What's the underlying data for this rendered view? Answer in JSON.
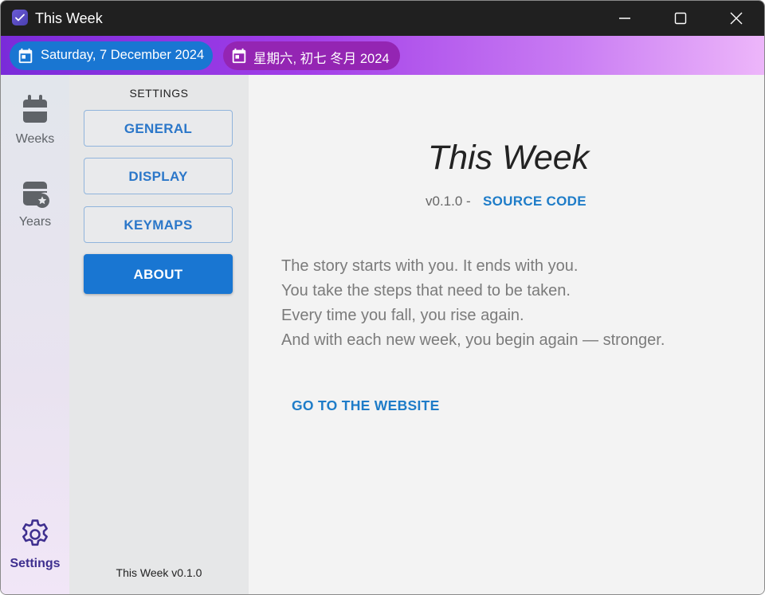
{
  "window": {
    "title": "This Week",
    "icon": "app-check-icon",
    "controls": [
      "minimize-icon",
      "maximize-icon",
      "close-icon"
    ]
  },
  "datebar": {
    "gregorian": "Saturday, 7 December 2024",
    "lunar": "星期六, 初七 冬月 2024",
    "icon": "calendar-icon"
  },
  "rail": {
    "items": [
      {
        "label": "Weeks",
        "icon": "calendar-week-icon"
      },
      {
        "label": "Years",
        "icon": "calendar-star-icon"
      },
      {
        "label": "Settings",
        "icon": "gear-icon",
        "active": true
      }
    ]
  },
  "panel": {
    "heading": "SETTINGS",
    "nav": [
      {
        "label": "GENERAL"
      },
      {
        "label": "DISPLAY"
      },
      {
        "label": "KEYMAPS"
      },
      {
        "label": "ABOUT",
        "active": true
      }
    ],
    "footer": "This Week v0.1.0"
  },
  "about": {
    "title": "This Week",
    "version": "v0.1.0 -",
    "source_link": "SOURCE CODE",
    "story": [
      "The story starts with you. It ends with you.",
      "You take the steps that need to be taken.",
      "Every time you fall, you rise again.",
      "And with each new week, you begin again — stronger."
    ],
    "website_link": "GO TO THE WEBSITE"
  },
  "colors": {
    "primary": "#1976d2",
    "lunar_pill": "#9425b3",
    "link": "#1e7cc8",
    "active_rail": "#3e2f8f"
  }
}
